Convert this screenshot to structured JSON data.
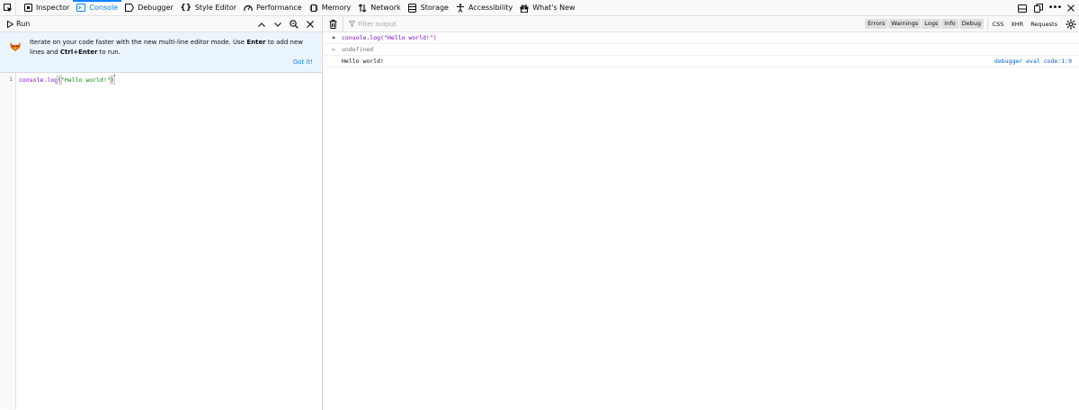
{
  "toolbar": {
    "tabs": [
      {
        "label": "Inspector",
        "icon": "inspector-icon"
      },
      {
        "label": "Console",
        "icon": "console-icon",
        "selected": true
      },
      {
        "label": "Debugger",
        "icon": "debugger-icon"
      },
      {
        "label": "Style Editor",
        "icon": "style-editor-icon"
      },
      {
        "label": "Performance",
        "icon": "performance-icon"
      },
      {
        "label": "Memory",
        "icon": "memory-icon"
      },
      {
        "label": "Network",
        "icon": "network-icon"
      },
      {
        "label": "Storage",
        "icon": "storage-icon"
      },
      {
        "label": "Accessibility",
        "icon": "accessibility-icon"
      },
      {
        "label": "What's New",
        "icon": "whats-new-icon"
      }
    ]
  },
  "editor": {
    "run_label": "Run",
    "notice": {
      "text_1": "Iterate on your code faster with the new multi-line editor mode. Use ",
      "key_1": "Enter",
      "text_2": " to add new lines and ",
      "key_2": "Ctrl+Enter",
      "text_3": " to run.",
      "got_it": "Got it!"
    },
    "line_number": "1",
    "code": {
      "ident": "console",
      "dot": ".",
      "method": "log",
      "open": "(",
      "string": "\"Hello world!\"",
      "close": ")"
    }
  },
  "console": {
    "filter_placeholder": "Filter output",
    "levels": [
      "Errors",
      "Warnings",
      "Logs",
      "Info",
      "Debug"
    ],
    "kinds": [
      "CSS",
      "XHR",
      "Requests"
    ],
    "messages": {
      "input": "console.log(\"Hello world!\")",
      "result": "undefined",
      "log": "Hello world!",
      "location": "debugger eval code:1:9"
    }
  },
  "colors": {
    "accent": "#0a84ff",
    "notice_bg": "#ebf5fd",
    "string": "#058b00",
    "identifier": "#8000d7"
  }
}
